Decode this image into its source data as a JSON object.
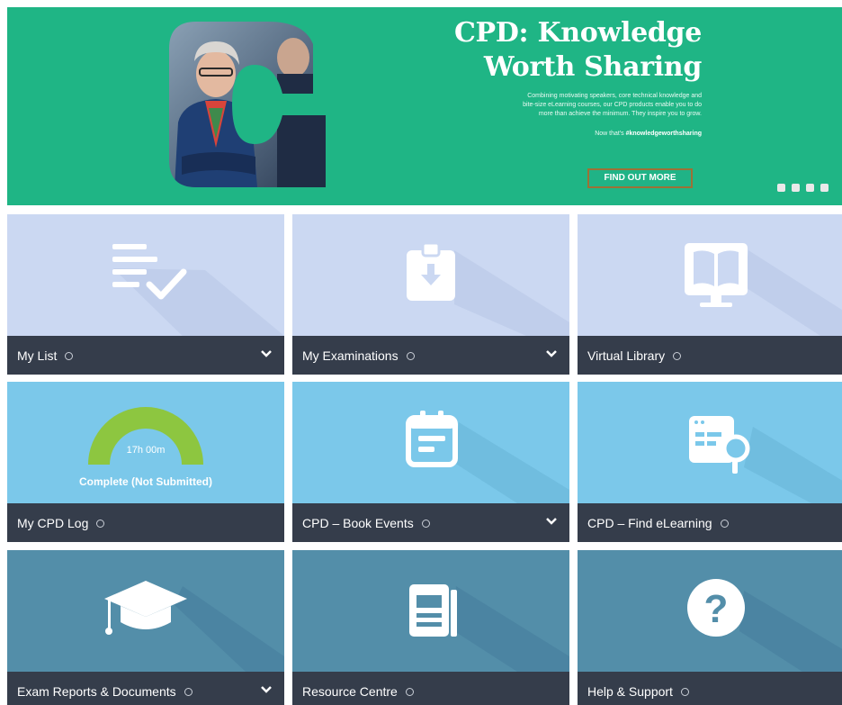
{
  "hero": {
    "title_line1": "CPD: Knowledge",
    "title_line2": "Worth Sharing",
    "body_line1": "Combining motivating speakers, core technical knowledge and",
    "body_line2": "bite-size eLearning courses, our CPD products enable you to do",
    "body_line3": "more than achieve the minimum. They inspire you to grow.",
    "tagline_prefix": "Now that's ",
    "tagline_hashtag": "#knowledgeworthsharing",
    "cta_label": "FIND OUT MORE",
    "background_color": "#1fb585",
    "cta_border_color": "#9c7136"
  },
  "tiles": [
    {
      "label": "My List",
      "icon": "checklist-icon",
      "has_dropdown": true
    },
    {
      "label": "My Examinations",
      "icon": "clipboard-download-icon",
      "has_dropdown": true
    },
    {
      "label": "Virtual Library",
      "icon": "book-monitor-icon",
      "has_dropdown": false
    },
    {
      "label": "My CPD Log",
      "icon": "progress-gauge-icon",
      "has_dropdown": false,
      "gauge": {
        "hours": "17h 00m",
        "status": "Complete (Not Submitted)",
        "progress": 1.0,
        "color": "#8dc640"
      }
    },
    {
      "label": "CPD – Book Events",
      "icon": "calendar-icon",
      "has_dropdown": true
    },
    {
      "label": "CPD – Find eLearning",
      "icon": "browser-search-icon",
      "has_dropdown": false
    },
    {
      "label": "Exam Reports & Documents",
      "icon": "graduation-cap-icon",
      "has_dropdown": true
    },
    {
      "label": "Resource Centre",
      "icon": "document-icon",
      "has_dropdown": false
    },
    {
      "label": "Help & Support",
      "icon": "question-icon",
      "has_dropdown": false
    }
  ],
  "colors": {
    "row1": "#cbd8f2",
    "row2": "#7bc8ea",
    "row3": "#538ea9",
    "footer": "#353d4b"
  }
}
